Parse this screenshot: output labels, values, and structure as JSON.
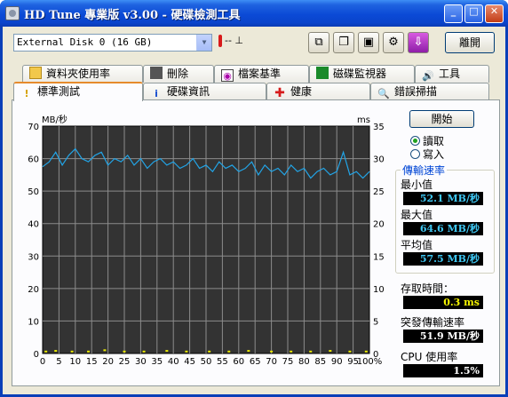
{
  "window": {
    "title": "HD Tune 專業版 v3.00 - 硬碟檢測工具",
    "controls": {
      "minimize": "_",
      "maximize": "□",
      "close": "✕"
    }
  },
  "toolbar": {
    "disk_select": "External Disk 0 (16 GB)",
    "temperature": "-- ⊥",
    "exit_label": "離開",
    "buttons": [
      "copy-info-icon",
      "copy-screenshot-icon",
      "save-icon",
      "options-icon",
      "download-icon"
    ]
  },
  "tabs": {
    "top": [
      "資料夾使用率",
      "刪除",
      "檔案基準",
      "磁碟監視器",
      "工具"
    ],
    "bottom": [
      "標準測試",
      "硬碟資訊",
      "健康",
      "錯誤掃描"
    ],
    "active": "標準測試"
  },
  "controls": {
    "start_label": "開始",
    "read_label": "讀取",
    "write_label": "寫入",
    "selected": "讀取"
  },
  "results": {
    "group_title": "傳輸速率",
    "min_label": "最小值",
    "min_value": "52.1 MB/秒",
    "max_label": "最大值",
    "max_value": "64.6 MB/秒",
    "avg_label": "平均值",
    "avg_value": "57.5 MB/秒",
    "access_label": "存取時間：",
    "access_value": "0.3 ms",
    "burst_label": "突發傳輸速率",
    "burst_value": "51.9 MB/秒",
    "cpu_label": "CPU 使用率",
    "cpu_value": "1.5%"
  },
  "colors": {
    "plot_bg": "#333333",
    "grid": "#8c8c8c",
    "transfer_line": "#22a4e6",
    "access_points": "#e8e800"
  },
  "chart_data": {
    "type": "line",
    "ylabel": "MB/秒",
    "y2label": "ms",
    "ylim": [
      0,
      70
    ],
    "y2lim": [
      0,
      35
    ],
    "yticks": [
      0,
      10,
      20,
      30,
      40,
      50,
      60,
      70
    ],
    "y2ticks": [
      0,
      5,
      10,
      15,
      20,
      25,
      30,
      35
    ],
    "xlim": [
      0,
      100
    ],
    "xticks": [
      "0",
      "5",
      "10",
      "15",
      "20",
      "25",
      "30",
      "35",
      "40",
      "45",
      "50",
      "55",
      "60",
      "65",
      "70",
      "75",
      "80",
      "85",
      "90",
      "95",
      "100%"
    ],
    "grid": true,
    "series": [
      {
        "axis": "left",
        "x": [
          0,
          2,
          4,
          6,
          8,
          10,
          12,
          14,
          16,
          18,
          20,
          22,
          24,
          26,
          28,
          30,
          32,
          34,
          36,
          38,
          40,
          42,
          44,
          46,
          48,
          50,
          52,
          54,
          56,
          58,
          60,
          62,
          64,
          66,
          68,
          70,
          72,
          74,
          76,
          78,
          80,
          82,
          84,
          86,
          88,
          90,
          92,
          94,
          96,
          98,
          100
        ],
        "values": [
          57.5,
          59,
          62,
          58,
          61,
          63,
          60,
          59,
          61,
          62,
          58,
          60,
          59,
          61,
          58,
          60,
          57,
          59,
          60,
          58,
          59,
          57,
          58,
          60,
          57,
          58,
          56,
          59,
          57,
          58,
          56,
          57,
          59,
          55,
          58,
          56,
          57,
          55,
          58,
          56,
          57,
          54,
          56,
          57,
          55,
          56,
          62,
          55,
          56,
          54,
          56
        ]
      },
      {
        "axis": "right",
        "x": [
          1,
          4,
          9,
          14,
          19,
          25,
          31,
          38,
          44,
          51,
          57,
          63,
          70,
          76,
          82,
          88,
          94,
          99
        ],
        "values": [
          0.3,
          0.4,
          0.3,
          0.3,
          0.5,
          0.3,
          0.3,
          0.4,
          0.3,
          0.3,
          0.3,
          0.4,
          0.3,
          0.3,
          0.3,
          0.4,
          0.3,
          0.3
        ]
      }
    ]
  }
}
